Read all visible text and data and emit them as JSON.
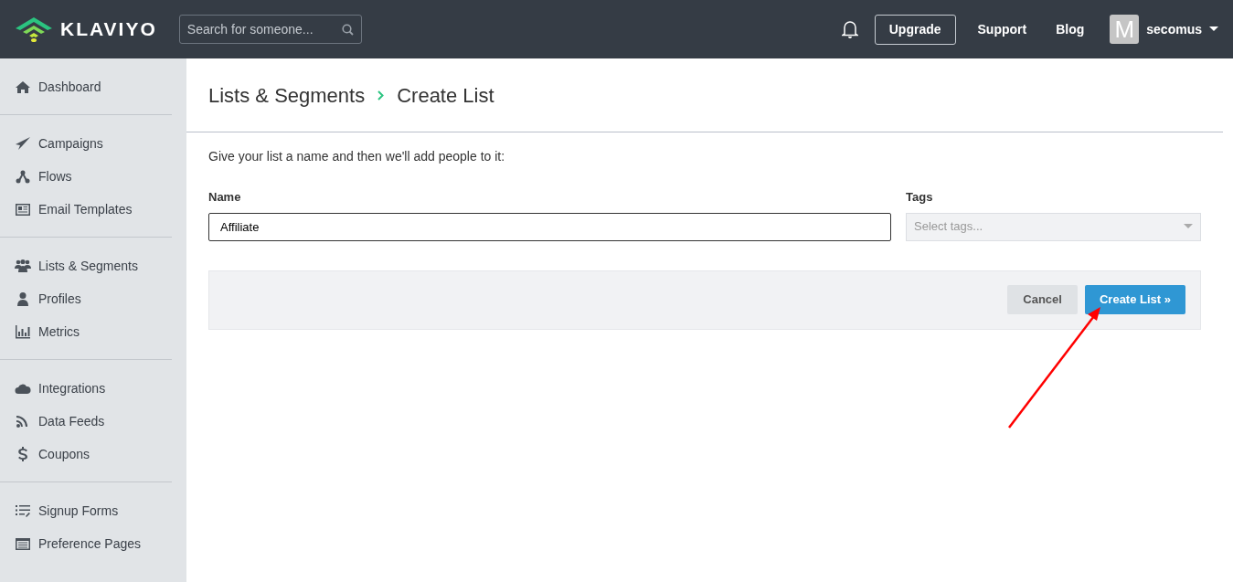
{
  "topbar": {
    "logo": "KLAVIYO",
    "search": {
      "placeholder": "Search for someone..."
    },
    "upgrade": "Upgrade",
    "links": [
      "Support",
      "Blog"
    ],
    "avatar_letter": "M",
    "user": "secomus"
  },
  "sidebar": {
    "groups": [
      {
        "items": [
          {
            "label": "Dashboard"
          }
        ]
      },
      {
        "items": [
          {
            "label": "Campaigns"
          },
          {
            "label": "Flows"
          },
          {
            "label": "Email Templates"
          }
        ]
      },
      {
        "items": [
          {
            "label": "Lists & Segments"
          },
          {
            "label": "Profiles"
          },
          {
            "label": "Metrics"
          }
        ]
      },
      {
        "items": [
          {
            "label": "Integrations"
          },
          {
            "label": "Data Feeds"
          },
          {
            "label": "Coupons"
          }
        ]
      },
      {
        "items": [
          {
            "label": "Signup Forms"
          },
          {
            "label": "Preference Pages"
          }
        ]
      }
    ]
  },
  "breadcrumb": [
    "Lists & Segments",
    "Create List"
  ],
  "intro": "Give your list a name and then we'll add people to it:",
  "form": {
    "name_label": "Name",
    "name_value": "Affiliate",
    "tags_label": "Tags",
    "tags_placeholder": "Select tags..."
  },
  "buttons": {
    "cancel": "Cancel",
    "create": "Create List »"
  }
}
